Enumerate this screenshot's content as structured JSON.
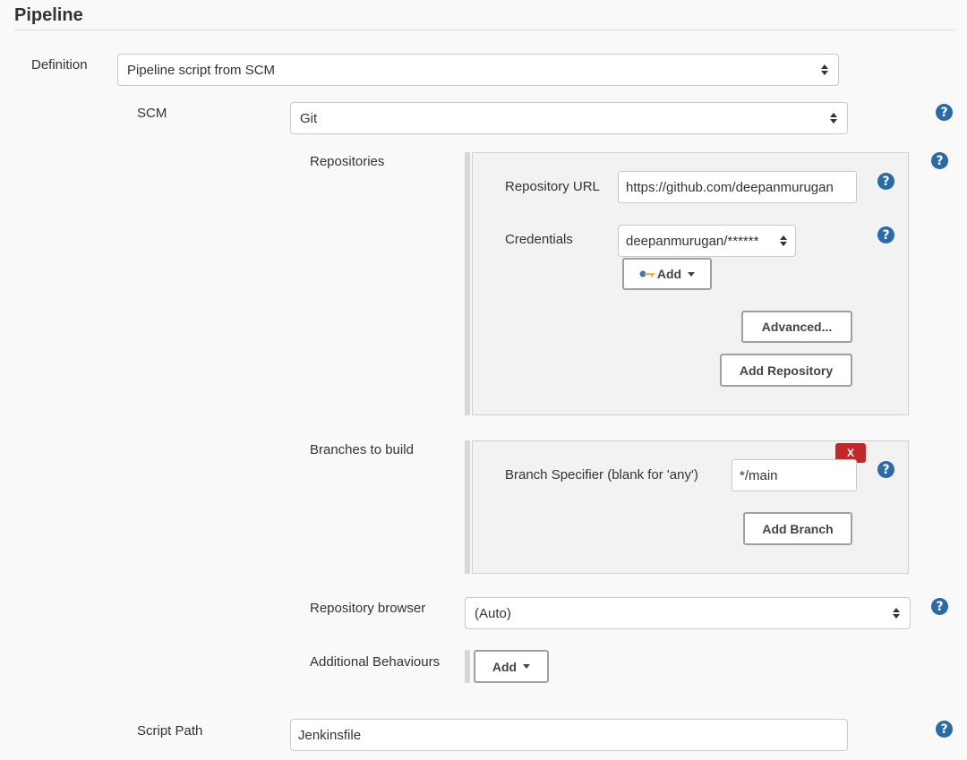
{
  "section": {
    "title": "Pipeline"
  },
  "definition": {
    "label": "Definition",
    "value": "Pipeline script from SCM"
  },
  "scm": {
    "label": "SCM",
    "value": "Git"
  },
  "repositories": {
    "label": "Repositories",
    "url_label": "Repository URL",
    "url_value": "https://github.com/deepanmurugan",
    "credentials_label": "Credentials",
    "credentials_value": "deepanmurugan/******",
    "add_label": "Add",
    "advanced_label": "Advanced...",
    "add_repository_label": "Add Repository"
  },
  "branches": {
    "label": "Branches to build",
    "delete_label": "X",
    "specifier_label": "Branch Specifier (blank for 'any')",
    "specifier_value": "*/main",
    "add_branch_label": "Add Branch"
  },
  "repo_browser": {
    "label": "Repository browser",
    "value": "(Auto)"
  },
  "additional": {
    "label": "Additional Behaviours",
    "add_label": "Add"
  },
  "script_path": {
    "label": "Script Path",
    "value": "Jenkinsfile"
  },
  "help_glyph": "?",
  "colors": {
    "help_blue": "#2a6aa8",
    "delete_red": "#c4272a",
    "panel_bg": "#f2f2f2",
    "page_bg": "#f9f9f9"
  }
}
